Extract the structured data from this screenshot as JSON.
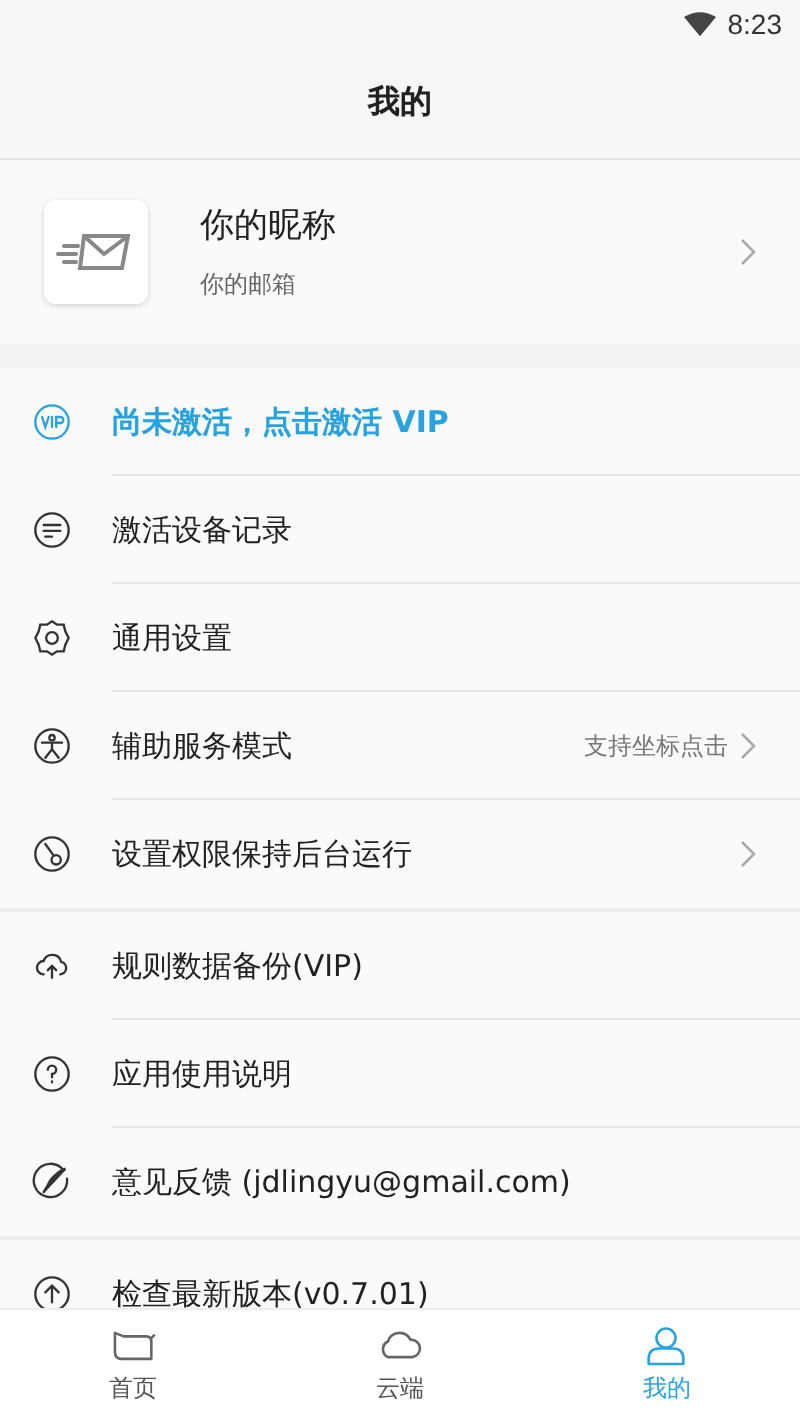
{
  "status_bar": {
    "time": "8:23"
  },
  "header": {
    "title": "我的"
  },
  "profile": {
    "nickname": "你的昵称",
    "email": "你的邮箱"
  },
  "sections": [
    [
      {
        "kind": "vip",
        "label": "尚未激活，点击激活 VIP",
        "chevron": false
      },
      {
        "kind": "normal",
        "label": "激活设备记录",
        "chevron": false
      },
      {
        "kind": "normal",
        "label": "通用设置",
        "chevron": false
      },
      {
        "kind": "normal",
        "label": "辅助服务模式",
        "detail": "支持坐标点击",
        "chevron": true
      },
      {
        "kind": "normal",
        "label": "设置权限保持后台运行",
        "chevron": true
      }
    ],
    [
      {
        "kind": "normal",
        "label": "规则数据备份(VIP)",
        "chevron": false
      },
      {
        "kind": "normal",
        "label": "应用使用说明",
        "chevron": false
      },
      {
        "kind": "normal",
        "label": "意见反馈 (jdlingyu@gmail.com)",
        "chevron": false
      }
    ],
    [
      {
        "kind": "normal",
        "label": "检查最新版本(v0.7.01)",
        "chevron": false
      }
    ]
  ],
  "tabs": [
    {
      "label": "首页",
      "selected": false
    },
    {
      "label": "云端",
      "selected": false
    },
    {
      "label": "我的",
      "selected": true
    }
  ]
}
